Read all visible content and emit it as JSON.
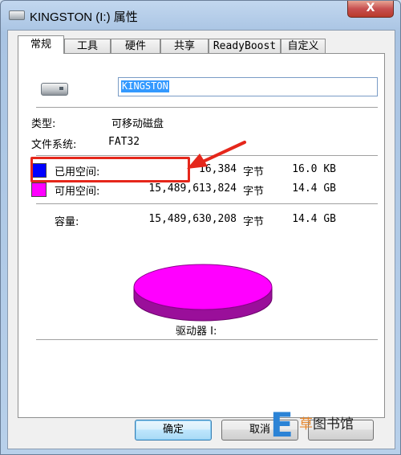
{
  "window": {
    "title": "KINGSTON (I:) 属性",
    "close_glyph": "X"
  },
  "tabs": [
    {
      "label": "常规",
      "active": true
    },
    {
      "label": "工具"
    },
    {
      "label": "硬件"
    },
    {
      "label": "共享"
    },
    {
      "label": "ReadyBoost"
    },
    {
      "label": "自定义"
    }
  ],
  "drive": {
    "icon": "usb-drive-icon",
    "name": "KINGSTON"
  },
  "info": {
    "type_label": "类型:",
    "type_value": "可移动磁盘",
    "fs_label": "文件系统:",
    "fs_value": "FAT32"
  },
  "space": {
    "used_label": "已用空间:",
    "used_bytes": "16,384",
    "used_unit": "字节",
    "used_size": "16.0 KB",
    "used_color": "#0000ff",
    "free_label": "可用空间:",
    "free_bytes": "15,489,613,824",
    "free_unit": "字节",
    "free_size": "14.4 GB",
    "free_color": "#ff00ff",
    "capacity_label": "容量:",
    "capacity_bytes": "15,489,630,208",
    "capacity_unit": "字节",
    "capacity_size": "14.4 GB"
  },
  "chart_data": {
    "type": "pie",
    "categories": [
      "已用空间",
      "可用空间"
    ],
    "values": [
      16384,
      15489613824
    ]
  },
  "drive_label": "驱动器 I:",
  "buttons": {
    "ok": "确定",
    "cancel": "取消"
  },
  "annotation": {
    "highlight_color": "#e5271b"
  },
  "watermark": {
    "brand": "E",
    "text_a": "草",
    "text_b": "图书馆"
  }
}
